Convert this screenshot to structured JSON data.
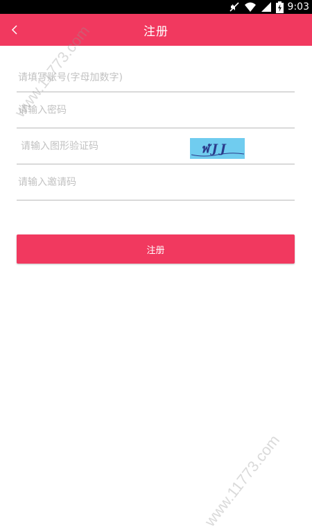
{
  "status_bar": {
    "time": "9:03",
    "icons": [
      "mute-icon",
      "wifi-icon",
      "signal-icon",
      "battery-charging-icon"
    ]
  },
  "header": {
    "title": "注册",
    "back_icon": "chevron-left-icon"
  },
  "form": {
    "account_placeholder": "请填写账号(字母加数字)",
    "password_placeholder": "请输入密码",
    "captcha_placeholder": "请输入图形验证码",
    "captcha_text": "ฬJJ",
    "invite_placeholder": "请输入邀请码"
  },
  "actions": {
    "register_label": "注册"
  },
  "watermark": {
    "text": "www.11773.com"
  },
  "colors": {
    "accent": "#f1395f",
    "captcha_bg": "#70ccef",
    "captcha_ink": "#2a3a8a"
  }
}
